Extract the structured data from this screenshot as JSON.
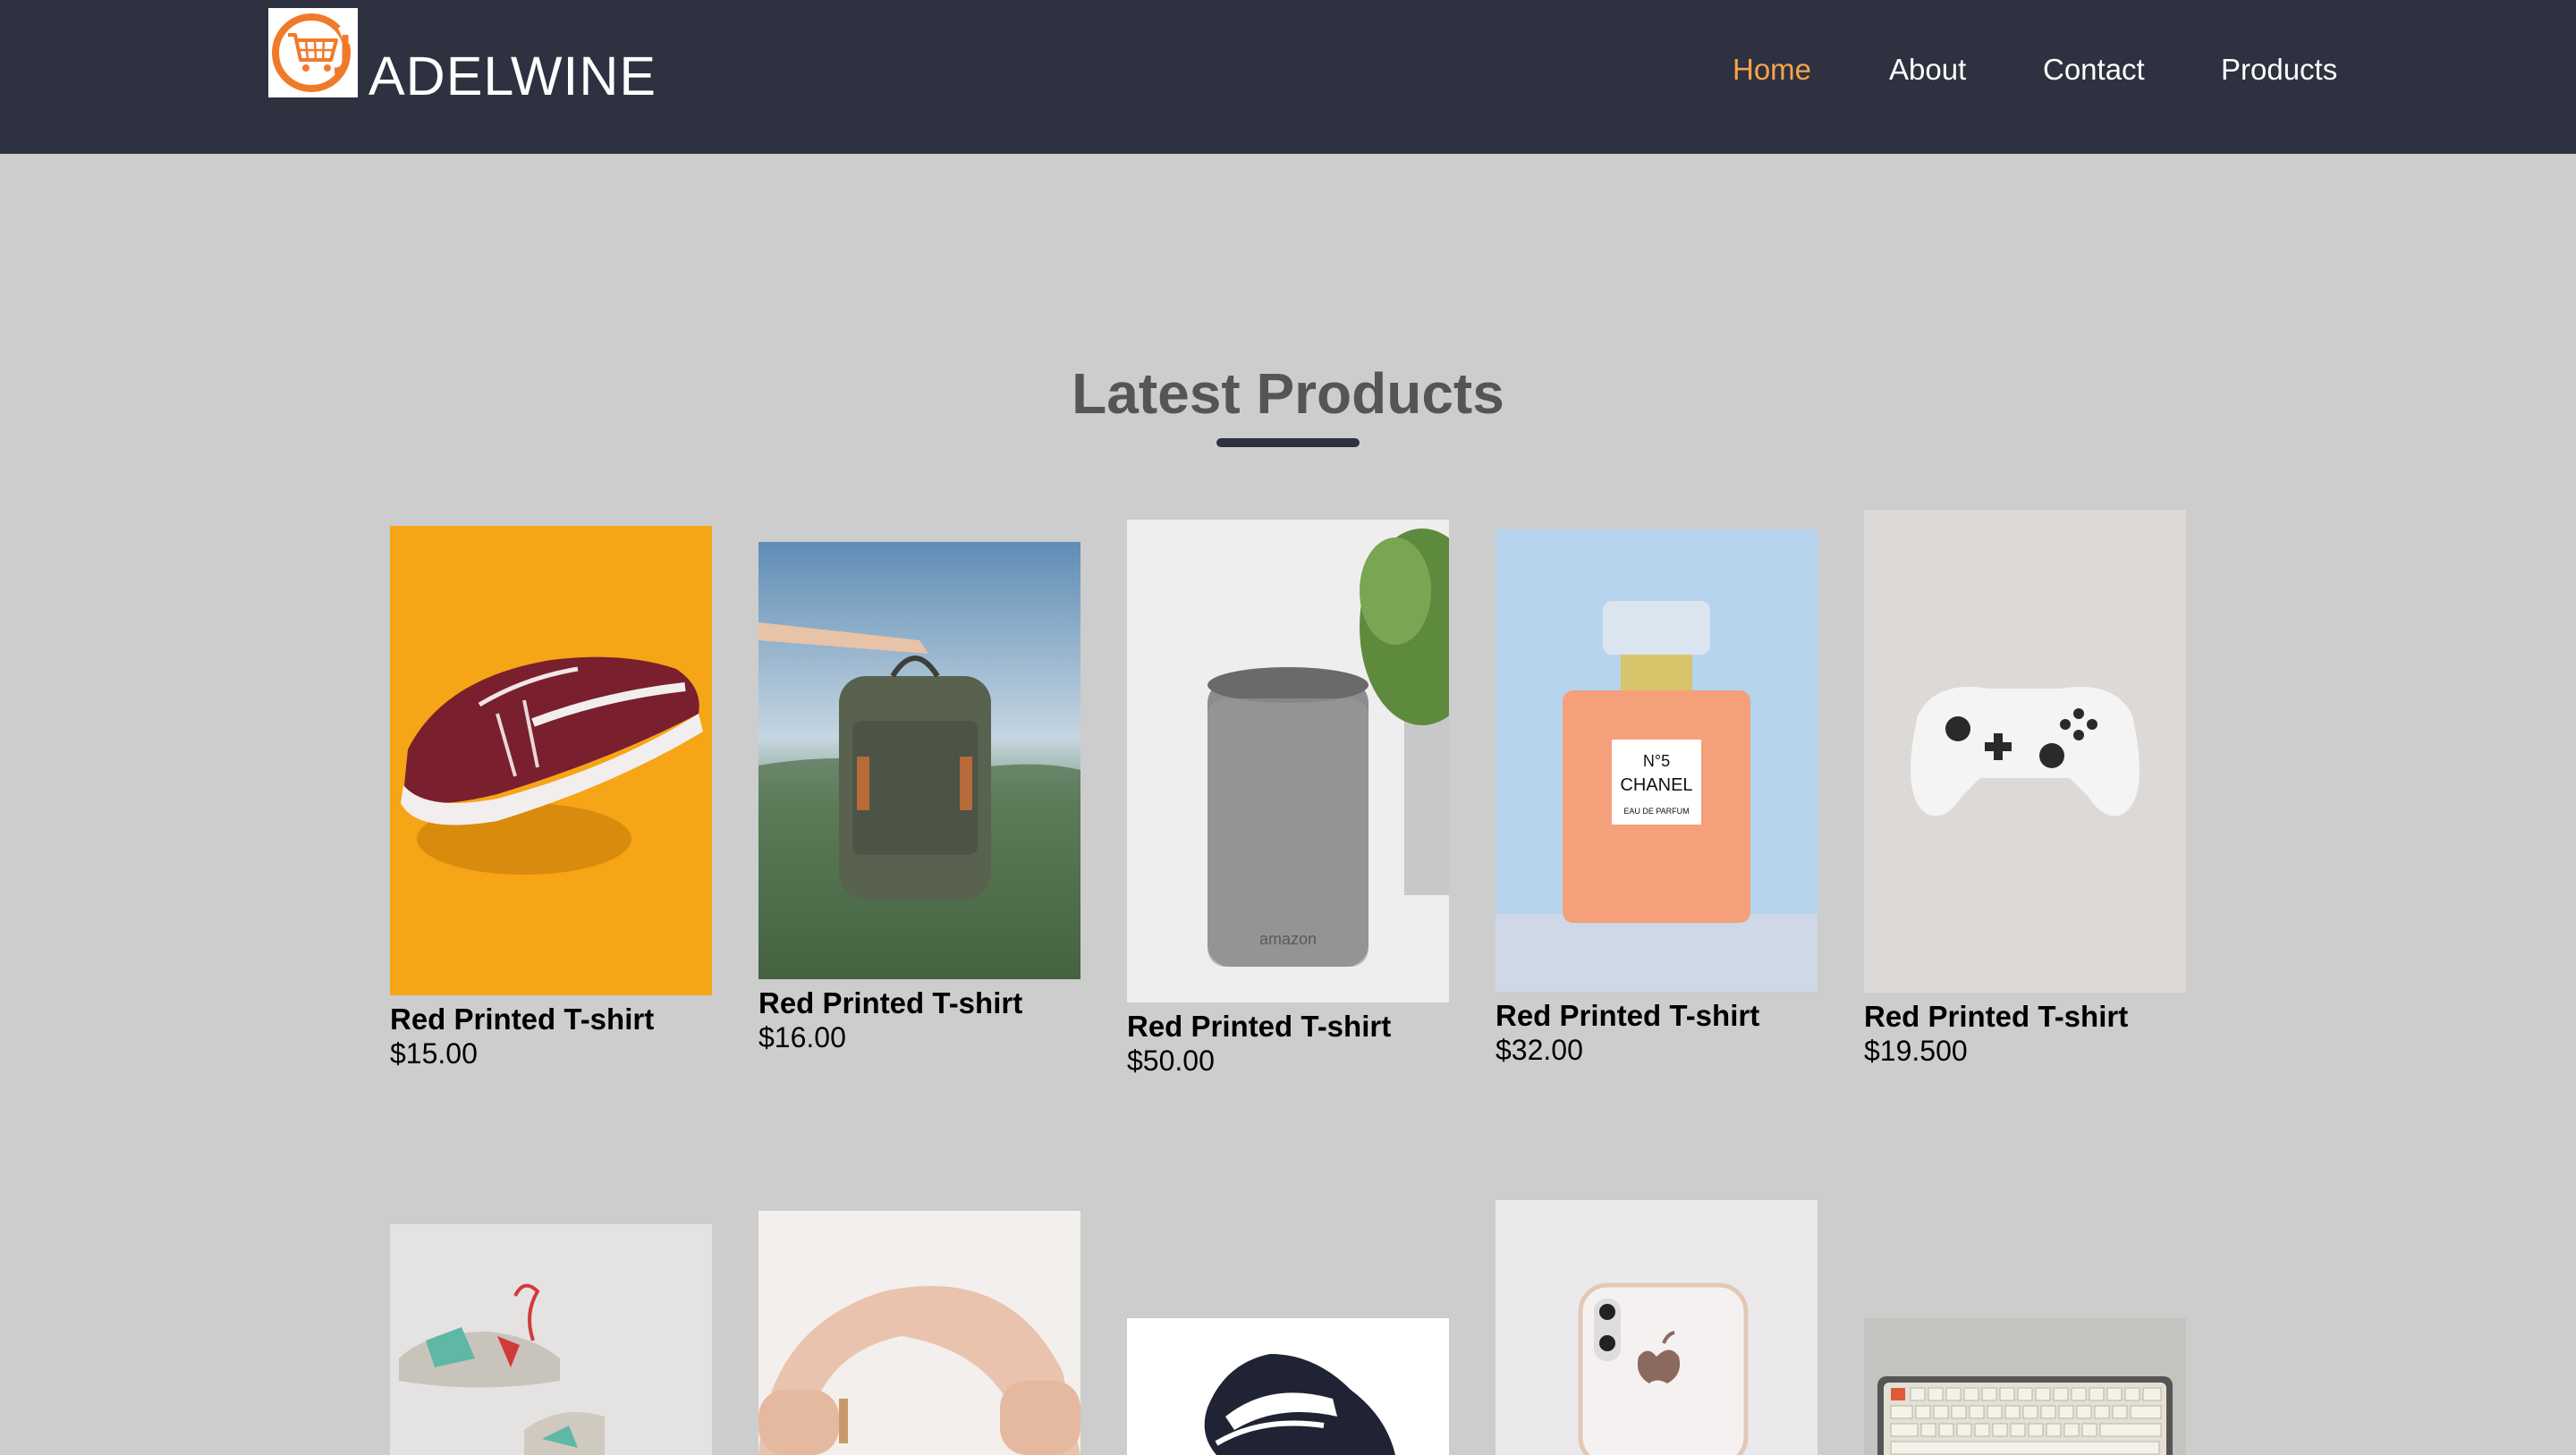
{
  "brand": {
    "name": "ADELWINE",
    "logo_icon": "shopping-cart-icon",
    "logo_color": "#f07a2a"
  },
  "nav": {
    "items": [
      {
        "label": "Home",
        "active": true
      },
      {
        "label": "About",
        "active": false
      },
      {
        "label": "Contact",
        "active": false
      },
      {
        "label": "Products",
        "active": false
      }
    ]
  },
  "section": {
    "title": "Latest Products"
  },
  "colors": {
    "navbar_bg": "#2d3140",
    "page_bg": "#cdcdcd",
    "accent": "#f7a44a",
    "title_text": "#555555"
  },
  "products": [
    {
      "name": "Red Printed T-shirt",
      "price": "$15.00",
      "image": "sneaker-photo"
    },
    {
      "name": "Red Printed T-shirt",
      "price": "$16.00",
      "image": "backpack-photo"
    },
    {
      "name": "Red Printed T-shirt",
      "price": "$50.00",
      "image": "smart-speaker-photo"
    },
    {
      "name": "Red Printed T-shirt",
      "price": "$32.00",
      "image": "perfume-bottle-photo"
    },
    {
      "name": "Red Printed T-shirt",
      "price": "$19.500",
      "image": "game-controller-photo"
    }
  ],
  "products_row2": [
    {
      "image": "running-shoes-photo"
    },
    {
      "image": "headphones-photo"
    },
    {
      "image": "black-sneaker-photo"
    },
    {
      "image": "smartphone-photo"
    },
    {
      "image": "keyboard-photo"
    }
  ],
  "image_text": {
    "perfume_label_1": "N°5",
    "perfume_label_2": "CHANEL",
    "perfume_label_3": "EAU DE PARFUM",
    "speaker_brand": "amazon"
  }
}
